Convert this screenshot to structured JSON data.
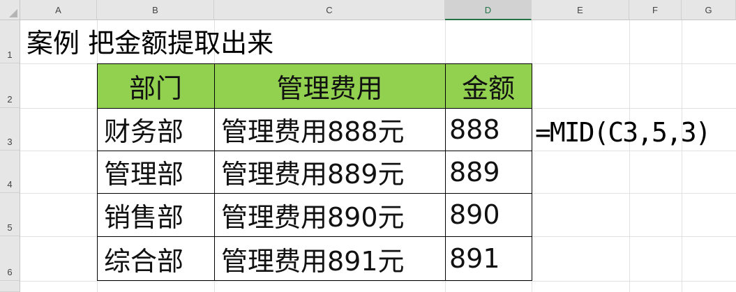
{
  "columns": [
    "A",
    "B",
    "C",
    "D",
    "E",
    "F",
    "G"
  ],
  "selected_column": "D",
  "rows": [
    "1",
    "2",
    "3",
    "4",
    "5",
    "6"
  ],
  "title": "案例 把金额提取出来",
  "table": {
    "headers": [
      "部门",
      "管理费用",
      "金额"
    ],
    "rows": [
      [
        "财务部",
        "管理费用888元",
        "888"
      ],
      [
        "管理部",
        "管理费用889元",
        "889"
      ],
      [
        "销售部",
        "管理费用890元",
        "890"
      ],
      [
        "综合部",
        "管理费用891元",
        "891"
      ]
    ]
  },
  "formula_text": "=MID(C3,5,3)",
  "colors": {
    "header_fill": "#92d050",
    "selected_header_accent": "#217346"
  }
}
